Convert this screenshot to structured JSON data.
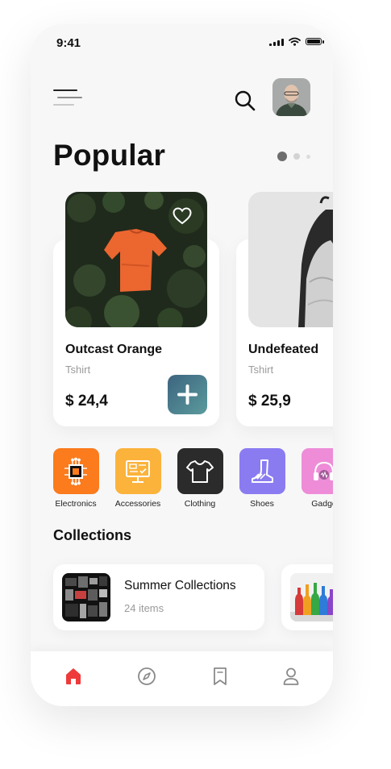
{
  "status_bar": {
    "time": "9:41",
    "icons": [
      "signal-icon",
      "wifi-icon",
      "battery-icon"
    ]
  },
  "header": {
    "menu_icon": "menu-icon",
    "search_icon": "search-icon",
    "avatar": "profile-avatar"
  },
  "popular": {
    "title": "Popular",
    "pager": {
      "pages": 3,
      "active": 1
    },
    "products": [
      {
        "name": "Outcast Orange",
        "category": "Tshirt",
        "price": "$ 24,4",
        "favorite_icon": "heart-icon",
        "add_icon": "plus-icon"
      },
      {
        "name": "Undefeated",
        "category": "Tshirt",
        "price": "$ 25,9"
      }
    ]
  },
  "categories": [
    {
      "label": "Electronics",
      "icon": "chip-icon",
      "color": "#fb7b1d"
    },
    {
      "label": "Accessories",
      "icon": "monitor-icon",
      "color": "#fbb33c"
    },
    {
      "label": "Clothing",
      "icon": "tshirt-icon",
      "color": "#2b2b2b"
    },
    {
      "label": "Shoes",
      "icon": "boot-icon",
      "color": "#8a7bf1"
    },
    {
      "label": "Gadge",
      "icon": "headphones-icon",
      "color": "#ee8cd8"
    }
  ],
  "collections": {
    "title": "Collections",
    "items": [
      {
        "name": "Summer Collections",
        "count": "24 items"
      }
    ]
  },
  "tabbar": {
    "tabs": [
      {
        "id": "home",
        "icon": "home-icon",
        "active": true
      },
      {
        "id": "explore",
        "icon": "compass-icon",
        "active": false
      },
      {
        "id": "saved",
        "icon": "bookmark-icon",
        "active": false
      },
      {
        "id": "profile",
        "icon": "user-icon",
        "active": false
      }
    ]
  },
  "colors": {
    "accent_red": "#ee3a3a",
    "text": "#111111",
    "muted": "#9a9a9a",
    "add_button": "#4d8592"
  }
}
